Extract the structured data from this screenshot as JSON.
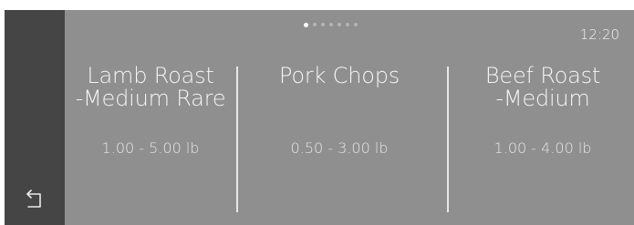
{
  "status": {
    "time": "12:20"
  },
  "pager": {
    "count": 7,
    "active": 0
  },
  "navigation": {
    "back_icon": "back-arrow-icon"
  },
  "recipes": [
    {
      "title": "Lamb Roast\n-Medium Rare",
      "weight_range": "1.00 - 5.00 lb"
    },
    {
      "title": "Pork Chops",
      "weight_range": "0.50 - 3.00 lb"
    },
    {
      "title": "Beef Roast\n-Medium",
      "weight_range": "1.00 - 4.00 lb"
    }
  ]
}
